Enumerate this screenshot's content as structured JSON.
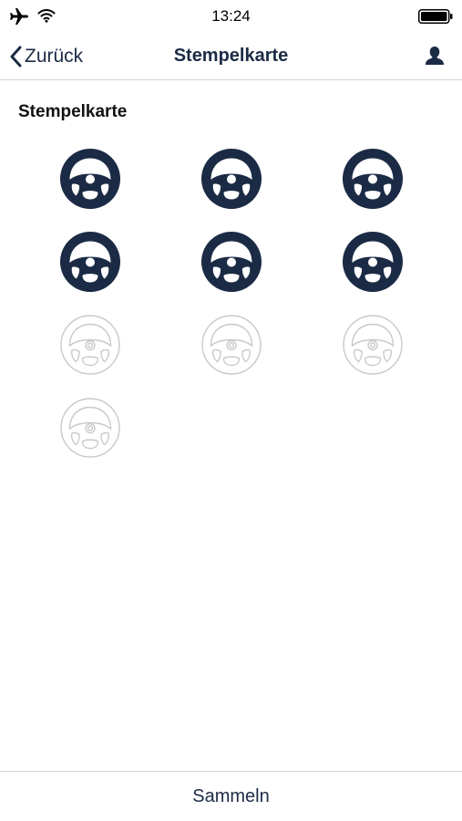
{
  "status_bar": {
    "time": "13:24",
    "icons": [
      "airplane-icon",
      "wifi-icon",
      "battery-icon"
    ]
  },
  "nav": {
    "back_label": "Zurück",
    "title": "Stempelkarte",
    "back_icon": "chevron-left-icon",
    "profile_icon": "person-icon"
  },
  "section": {
    "title": "Stempelkarte"
  },
  "stamp_card": {
    "icon": "steering-wheel-icon",
    "total": 10,
    "collected": 6,
    "columns": 3,
    "filled_color": "#1c2b45",
    "empty_color": "#c9c9cc"
  },
  "footer": {
    "collect_label": "Sammeln"
  }
}
